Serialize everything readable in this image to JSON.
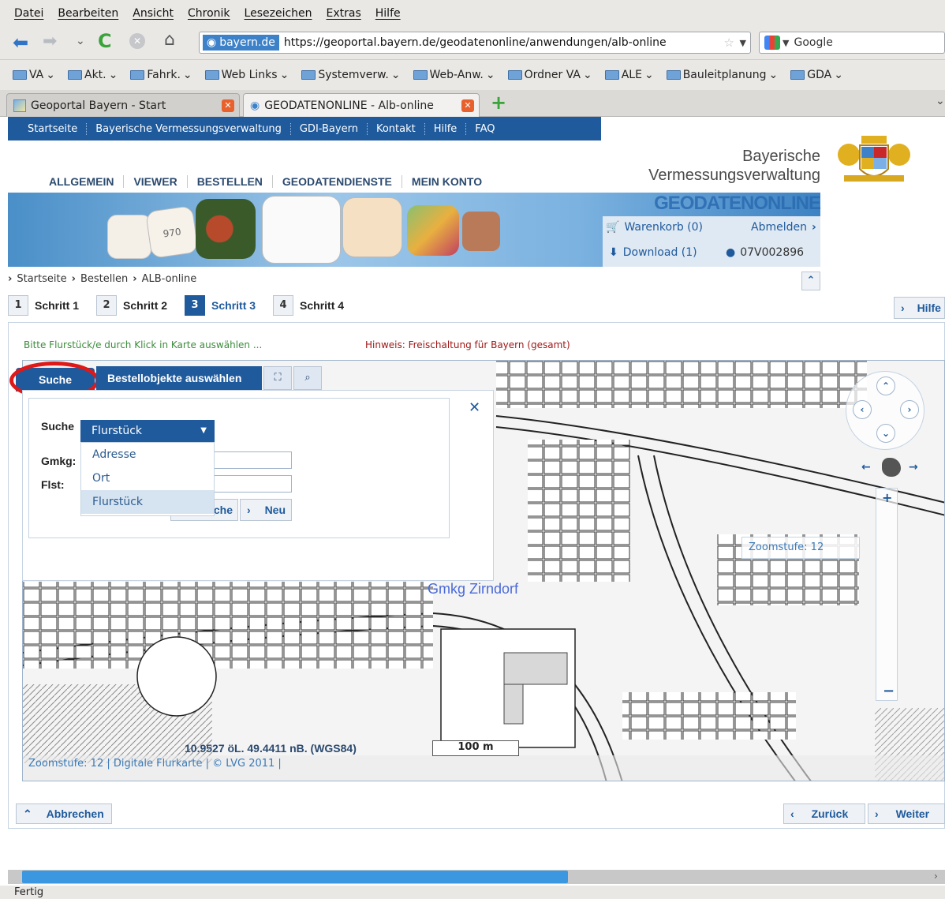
{
  "menubar": [
    "Datei",
    "Bearbeiten",
    "Ansicht",
    "Chronik",
    "Lesezeichen",
    "Extras",
    "Hilfe"
  ],
  "navbar": {
    "site_badge": "bayern.de",
    "url": "https://geoportal.bayern.de/geodatenonline/anwendungen/alb-online",
    "search_engine": "Google"
  },
  "bookmarks": [
    "VA",
    "Akt.",
    "Fahrk.",
    "Web Links",
    "Systemverw.",
    "Web-Anw.",
    "Ordner VA",
    "ALE",
    "Bauleitplanung",
    "GDA"
  ],
  "tabs": [
    {
      "label": "Geoportal Bayern - Start",
      "active": false
    },
    {
      "label": "GEODATENONLINE - Alb-online",
      "active": true
    }
  ],
  "site_nav": [
    "Startseite",
    "Bayerische Vermessungsverwaltung",
    "GDI-Bayern",
    "Kontakt",
    "Hilfe",
    "FAQ"
  ],
  "brand": {
    "line1": "Bayerische",
    "line2": "Vermessungsverwaltung",
    "product": "GEODATENONLINE"
  },
  "main_menu": [
    "ALLGEMEIN",
    "VIEWER",
    "BESTELLEN",
    "GEODATENDIENSTE",
    "MEIN KONTO"
  ],
  "account": {
    "cart": "Warenkorb (0)",
    "logout": "Abmelden",
    "download": "Download (1)",
    "user": "07V002896"
  },
  "breadcrumb": [
    "Startseite",
    "Bestellen",
    "ALB-online"
  ],
  "steps": [
    {
      "num": "1",
      "label": "Schritt 1",
      "active": false
    },
    {
      "num": "2",
      "label": "Schritt 2",
      "active": false
    },
    {
      "num": "3",
      "label": "Schritt 3",
      "active": true
    },
    {
      "num": "4",
      "label": "Schritt 4",
      "active": false
    }
  ],
  "help_label": "Hilfe",
  "hint_green": "Bitte Flurstück/e durch Klick in Karte auswählen ...",
  "hint_red": "Hinweis: Freischaltung für Bayern (gesamt)",
  "map_tabs": {
    "search": "Suche",
    "objects": "Bestellobjekte auswählen"
  },
  "search_form": {
    "suche_label": "Suche",
    "selected": "Flurstück",
    "options": [
      "Adresse",
      "Ort",
      "Flurstück"
    ],
    "gmkg_label": "Gmkg:",
    "flst_label": "Flst:",
    "search_btn": "Suche",
    "new_btn": "Neu"
  },
  "map": {
    "gemarkung": "Gmkg Zirndorf",
    "zoom_label": "Zoomstufe: 12",
    "coords": "10.9527 öL. 49.4411 nB. (WGS84)",
    "scale": "100 m",
    "attribution": "Zoomstufe: 12 | Digitale Flurkarte | © LVG 2011 |"
  },
  "footer": {
    "cancel": "Abbrechen",
    "back": "Zurück",
    "next": "Weiter"
  },
  "status": "Fertig"
}
